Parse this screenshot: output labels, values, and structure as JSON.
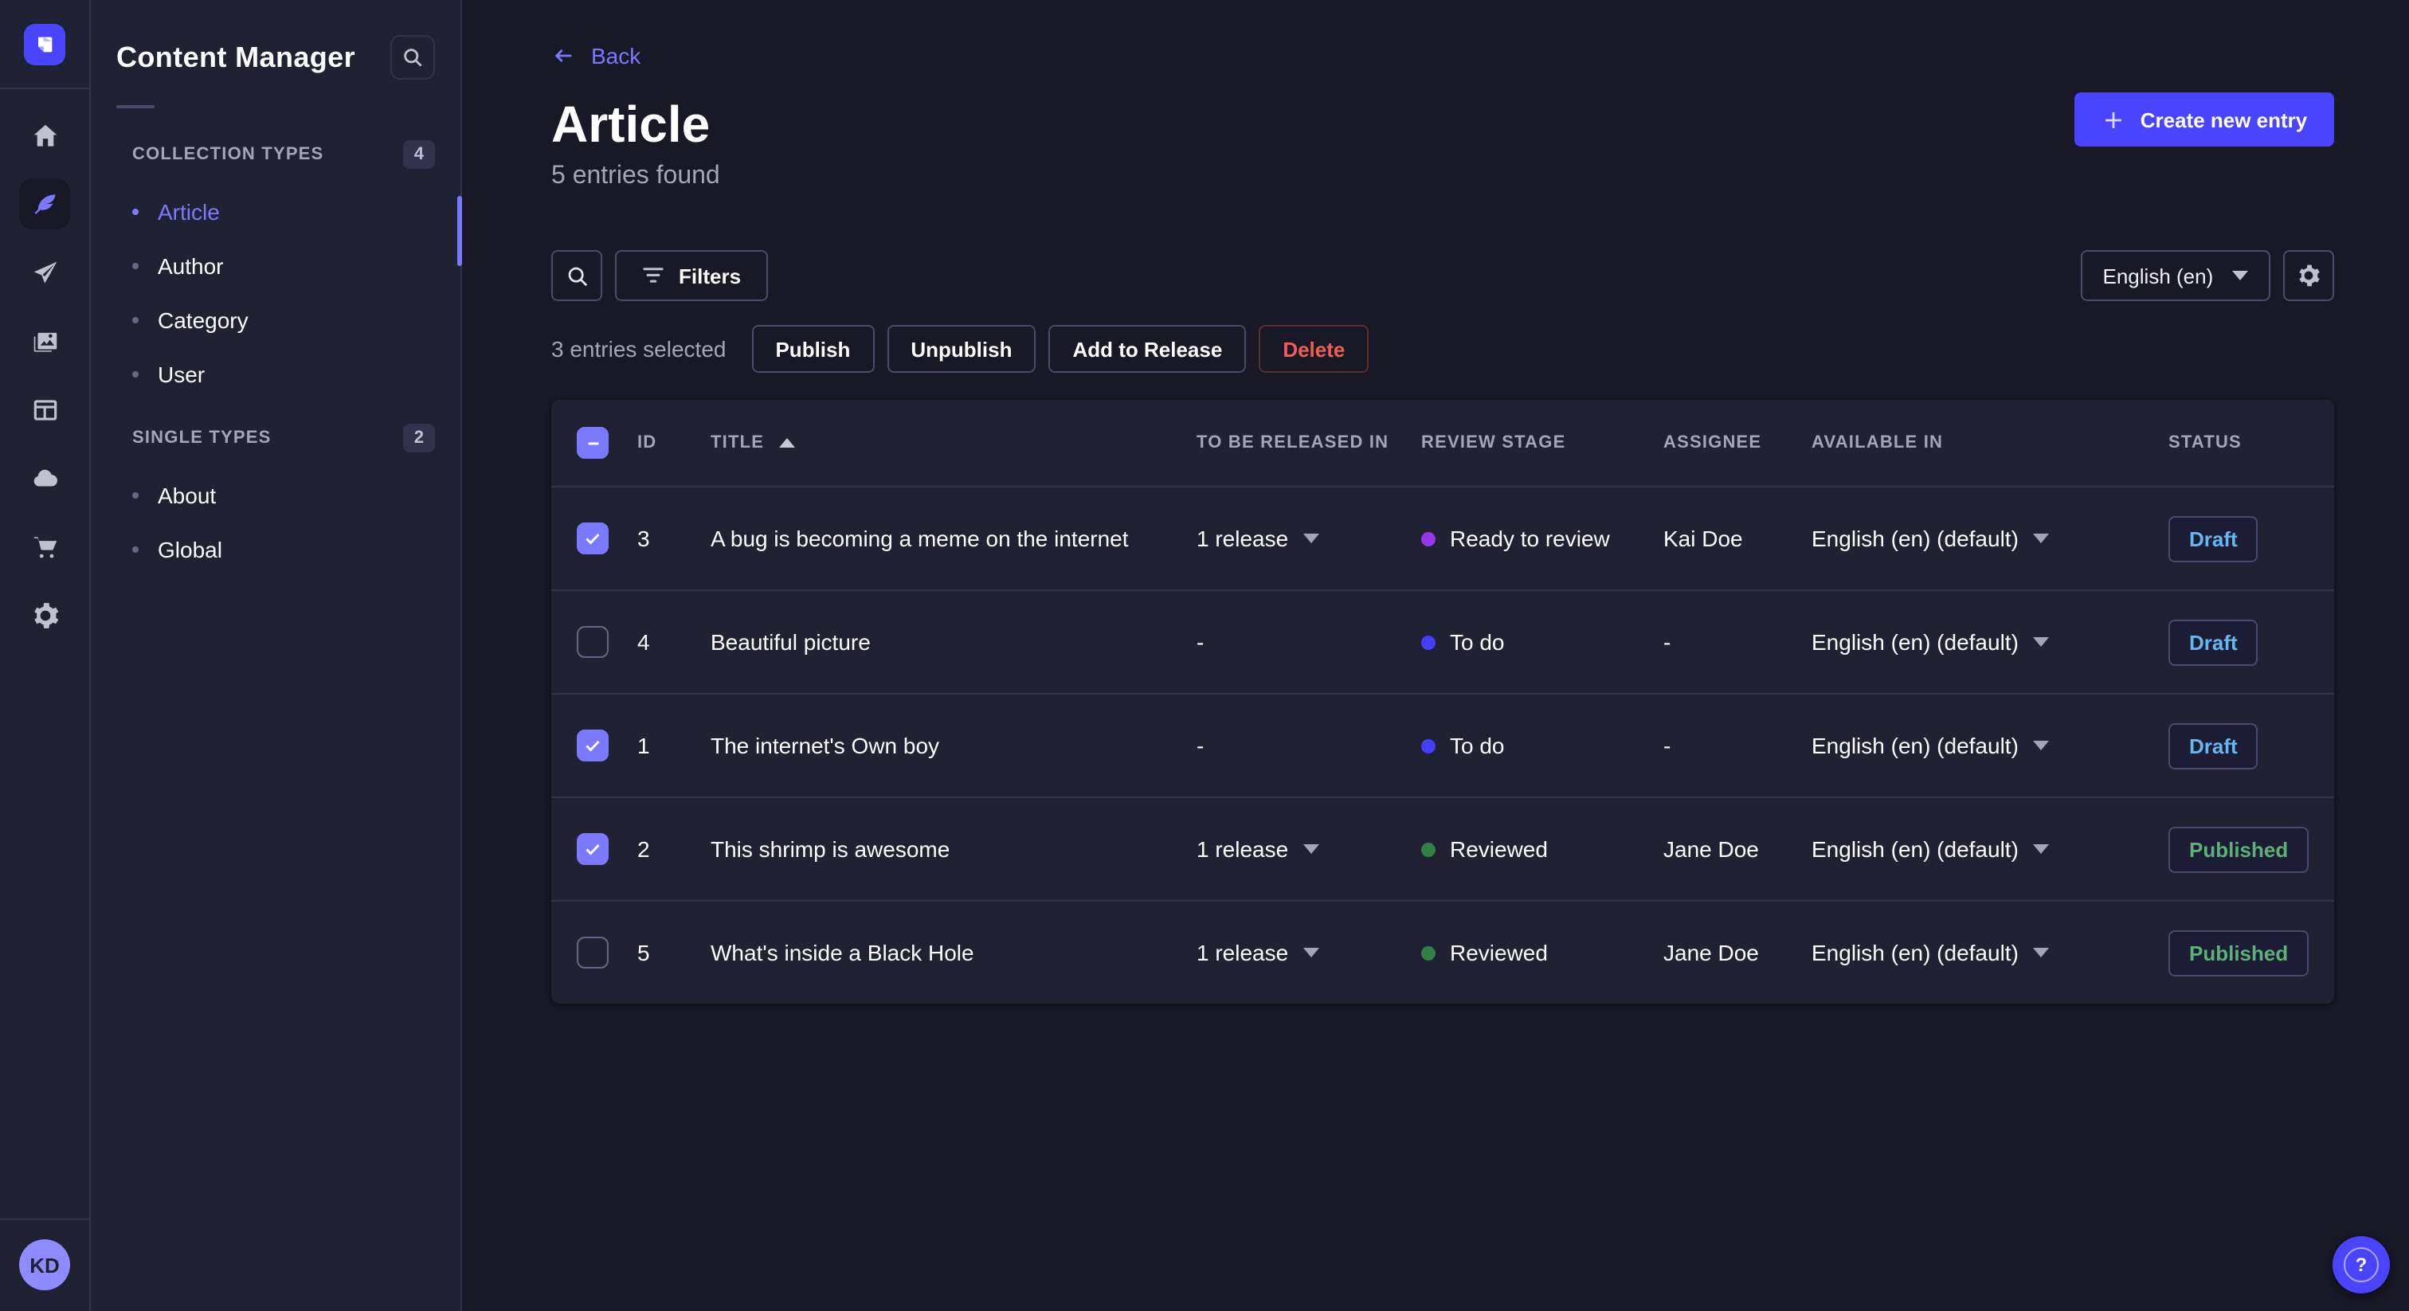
{
  "colors": {
    "primary": "#4945ff",
    "primary_light": "#7b79ff",
    "background": "#181826",
    "panel": "#212134",
    "border_subtle": "#32324d",
    "border_input": "#4a4a6a",
    "text_secondary": "#a5a5ba",
    "danger": "#ee5e52",
    "draft_text": "#66b7f1",
    "published_text": "#5cb176"
  },
  "rail": {
    "logo_icon": "strapi-logo-icon",
    "items": [
      {
        "icon": "home-icon",
        "active": false
      },
      {
        "icon": "content-manager-feather-icon",
        "active": true
      },
      {
        "icon": "releases-paper-plane-icon",
        "active": false
      },
      {
        "icon": "media-library-icon",
        "active": false
      },
      {
        "icon": "content-type-builder-icon",
        "active": false
      },
      {
        "icon": "deploy-cloud-icon",
        "active": false
      },
      {
        "icon": "marketplace-cart-icon",
        "active": false
      },
      {
        "icon": "settings-gear-icon",
        "active": false
      }
    ],
    "avatar_initials": "KD"
  },
  "sidebar": {
    "title": "Content Manager",
    "sections": [
      {
        "label": "COLLECTION TYPES",
        "count": "4",
        "items": [
          {
            "label": "Article",
            "active": true
          },
          {
            "label": "Author",
            "active": false
          },
          {
            "label": "Category",
            "active": false
          },
          {
            "label": "User",
            "active": false
          }
        ]
      },
      {
        "label": "SINGLE TYPES",
        "count": "2",
        "items": [
          {
            "label": "About",
            "active": false
          },
          {
            "label": "Global",
            "active": false
          }
        ]
      }
    ]
  },
  "header": {
    "back_label": "Back",
    "title": "Article",
    "subtitle": "5 entries found",
    "create_button_label": "Create new entry"
  },
  "toolbar": {
    "filters_label": "Filters",
    "locale_value": "English (en)"
  },
  "selection": {
    "text": "3 entries selected",
    "buttons": [
      {
        "label": "Publish",
        "variant": "default"
      },
      {
        "label": "Unpublish",
        "variant": "default"
      },
      {
        "label": "Add to Release",
        "variant": "default"
      },
      {
        "label": "Delete",
        "variant": "danger"
      }
    ]
  },
  "table": {
    "columns": [
      "ID",
      "TITLE",
      "TO BE RELEASED IN",
      "REVIEW STAGE",
      "ASSIGNEE",
      "AVAILABLE IN",
      "STATUS"
    ],
    "sorted_column": "TITLE",
    "sort_direction": "asc",
    "header_checkbox_state": "indeterminate",
    "rows": [
      {
        "selected": true,
        "id": "3",
        "title": "A bug is becoming a meme on the internet",
        "release": "1 release",
        "review_stage": "Ready to review",
        "review_color": "#9736e8",
        "assignee": "Kai Doe",
        "available_in": "English (en) (default)",
        "status": "Draft"
      },
      {
        "selected": false,
        "id": "4",
        "title": "Beautiful picture",
        "release": "-",
        "review_stage": "To do",
        "review_color": "#4240ff",
        "assignee": "-",
        "available_in": "English (en) (default)",
        "status": "Draft"
      },
      {
        "selected": true,
        "id": "1",
        "title": "The internet's Own boy",
        "release": "-",
        "review_stage": "To do",
        "review_color": "#4240ff",
        "assignee": "-",
        "available_in": "English (en) (default)",
        "status": "Draft"
      },
      {
        "selected": true,
        "id": "2",
        "title": "This shrimp is awesome",
        "release": "1 release",
        "review_stage": "Reviewed",
        "review_color": "#328048",
        "assignee": "Jane Doe",
        "available_in": "English (en) (default)",
        "status": "Published"
      },
      {
        "selected": false,
        "id": "5",
        "title": "What's inside a Black Hole",
        "release": "1 release",
        "review_stage": "Reviewed",
        "review_color": "#328048",
        "assignee": "Jane Doe",
        "available_in": "English (en) (default)",
        "status": "Published"
      }
    ]
  },
  "help": {
    "label": "?"
  }
}
